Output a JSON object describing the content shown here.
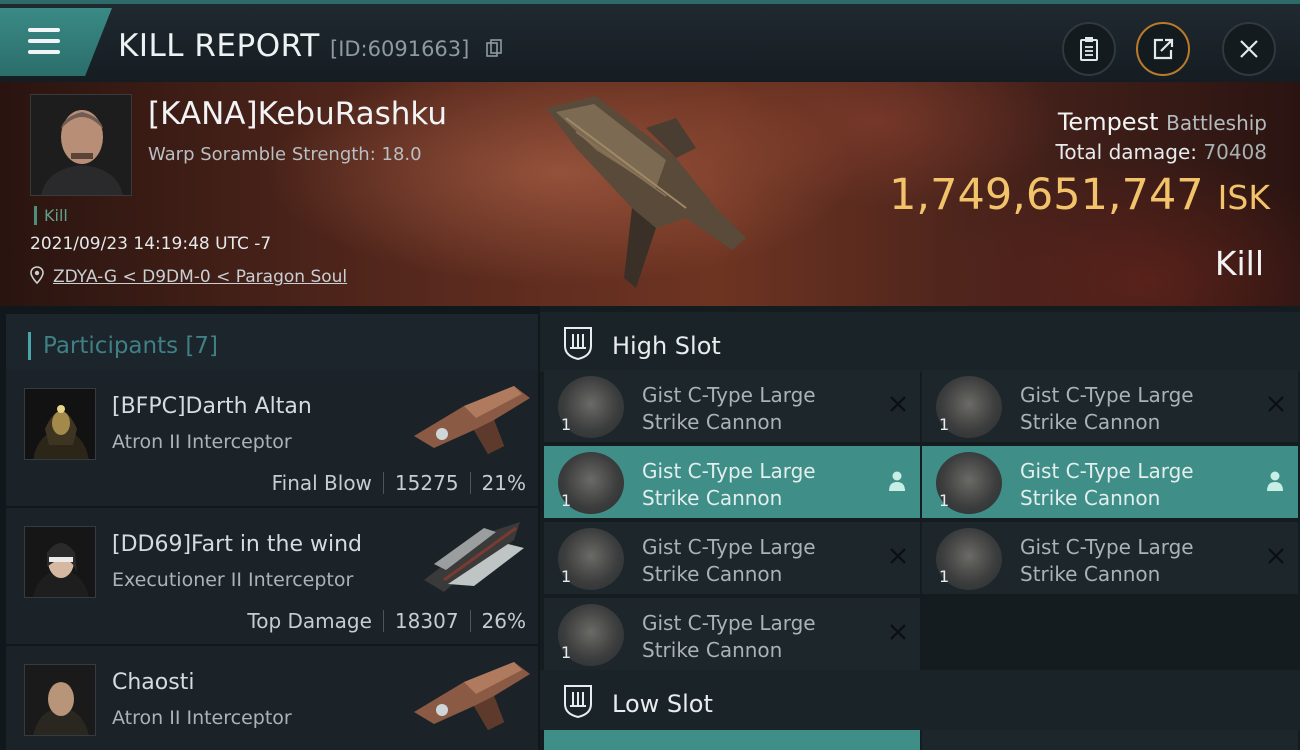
{
  "header": {
    "title": "KILL REPORT",
    "report_id": "[ID:6091663]"
  },
  "victim": {
    "name": "[KANA]KebuRashku",
    "subline": "Warp Soramble Strength: 18.0",
    "tag": "Kill",
    "timestamp": "2021/09/23 14:19:48 UTC -7",
    "location": "ZDYA-G < D9DM-0 < Paragon Soul"
  },
  "summary": {
    "ship_name": "Tempest",
    "ship_class": "Battleship",
    "total_damage_label": "Total damage:",
    "total_damage": "70408",
    "isk_value": "1,749,651,747",
    "isk_unit": "ISK",
    "result": "Kill",
    "accent_color": "#f2c36b"
  },
  "participants": {
    "title": "Participants [7]",
    "items": [
      {
        "name": "[BFPC]Darth Altan",
        "ship": "Atron II Interceptor",
        "role": "Final Blow",
        "damage": "15275",
        "percent": "21%"
      },
      {
        "name": "[DD69]Fart in the wind",
        "ship": "Executioner II Interceptor",
        "role": "Top Damage",
        "damage": "18307",
        "percent": "26%"
      },
      {
        "name": "Chaosti",
        "ship": "Atron II Interceptor",
        "role": "",
        "damage": "",
        "percent": ""
      }
    ]
  },
  "slots": {
    "high_label": "High Slot",
    "low_label": "Low Slot",
    "high_modules": [
      {
        "name_line1": "Gist C-Type Large",
        "name_line2": "Strike Cannon",
        "qty": "1",
        "state": "destroyed"
      },
      {
        "name_line1": "Gist C-Type Large",
        "name_line2": "Strike Cannon",
        "qty": "1",
        "state": "destroyed"
      },
      {
        "name_line1": "Gist C-Type Large",
        "name_line2": "Strike Cannon",
        "qty": "1",
        "state": "dropped"
      },
      {
        "name_line1": "Gist C-Type Large",
        "name_line2": "Strike Cannon",
        "qty": "1",
        "state": "dropped"
      },
      {
        "name_line1": "Gist C-Type Large",
        "name_line2": "Strike Cannon",
        "qty": "1",
        "state": "destroyed"
      },
      {
        "name_line1": "Gist C-Type Large",
        "name_line2": "Strike Cannon",
        "qty": "1",
        "state": "destroyed"
      },
      {
        "name_line1": "Gist C-Type Large",
        "name_line2": "Strike Cannon",
        "qty": "1",
        "state": "destroyed"
      }
    ]
  },
  "colors": {
    "teal": "#3f8f88",
    "gold": "#f2c36b",
    "banner_red": "#6e3422"
  }
}
